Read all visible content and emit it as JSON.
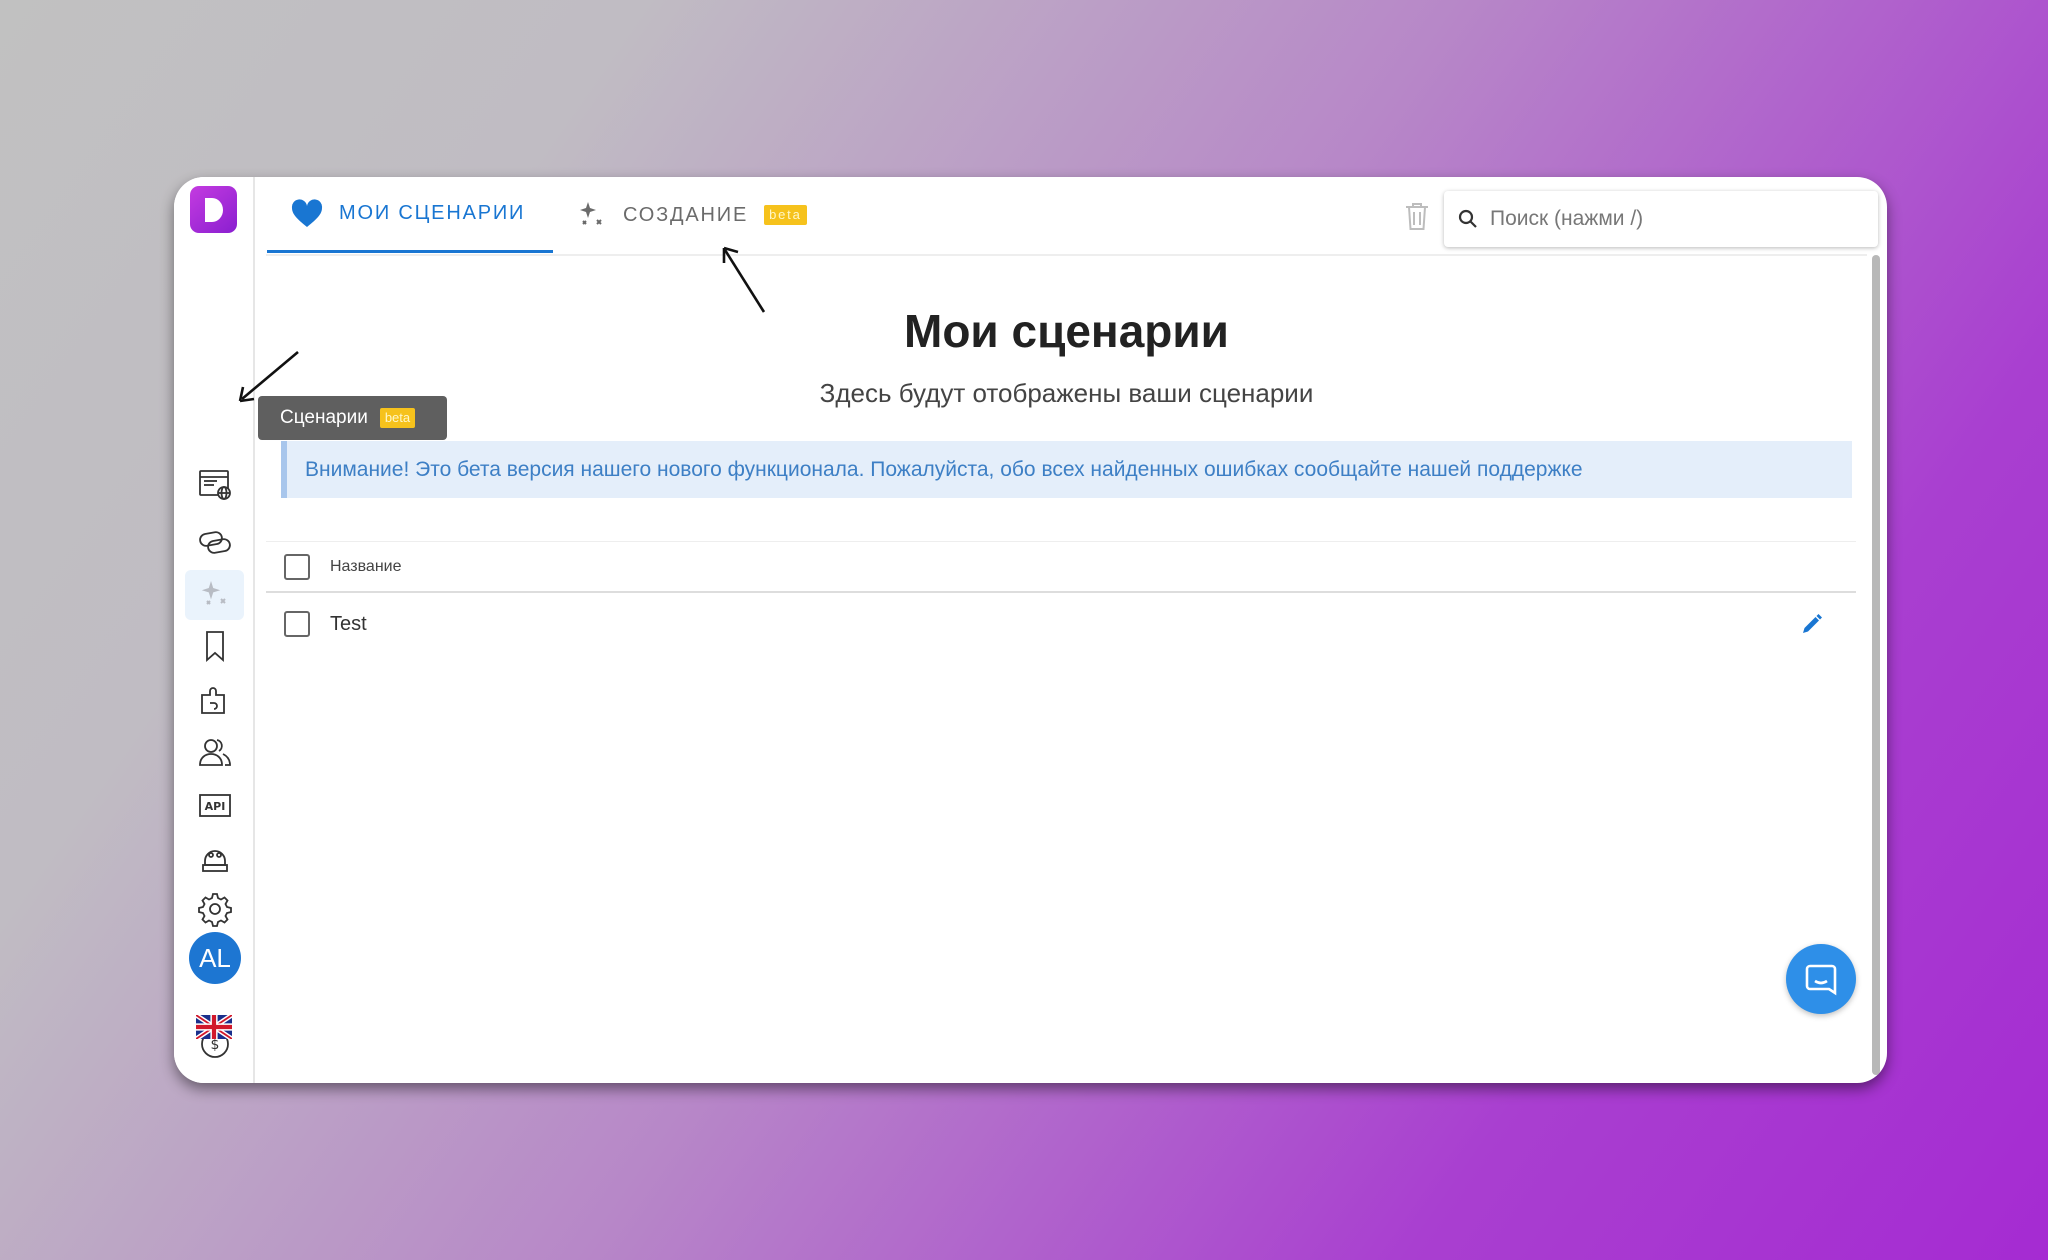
{
  "tabs": [
    {
      "label": "МОИ СЦЕНАРИИ",
      "icon": "heart-icon",
      "active": true
    },
    {
      "label": "СОЗДАНИЕ",
      "icon": "sparkles-icon",
      "badge": "beta"
    }
  ],
  "search": {
    "placeholder": "Поиск (нажми /)"
  },
  "sidebar": {
    "items": [
      {
        "name": "browser-globe-icon"
      },
      {
        "name": "links-icon"
      },
      {
        "name": "sparkles-icon",
        "active": true
      },
      {
        "name": "bookmark-icon"
      },
      {
        "name": "puzzle-icon"
      },
      {
        "name": "users-icon"
      },
      {
        "name": "api-icon"
      },
      {
        "name": "robot-icon"
      },
      {
        "name": "gear-icon"
      },
      {
        "name": "logout-icon"
      },
      {
        "name": "dollar-icon"
      }
    ],
    "avatar": "AL",
    "language": "en-flag-icon"
  },
  "tooltip": {
    "label": "Сценарии",
    "badge": "beta"
  },
  "main": {
    "title": "Мои сценарии",
    "subtitle": "Здесь будут отображены ваши сценарии",
    "alert": "Внимание! Это бета версия нашего нового функционала. Пожалуйста, обо всех найденных ошибках сообщайте нашей поддержке",
    "table": {
      "header": "Название",
      "rows": [
        {
          "name": "Test"
        }
      ]
    }
  },
  "colors": {
    "accent": "#1976d2",
    "beta": "#f6c21c",
    "logo": "#b52fdb"
  }
}
